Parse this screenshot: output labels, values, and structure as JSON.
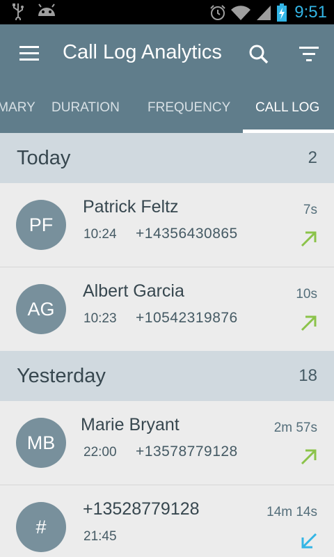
{
  "status_bar": {
    "time": "9:51",
    "icons": [
      "usb-icon",
      "android-icon",
      "alarm-icon",
      "wifi-icon",
      "signal-icon",
      "battery-charging-icon"
    ]
  },
  "toolbar": {
    "title": "Call Log Analytics",
    "menu_icon": "menu-icon",
    "search_icon": "search-icon",
    "filter_icon": "filter-icon"
  },
  "tabs": [
    {
      "label": "SUMMARY",
      "active": false
    },
    {
      "label": "DURATION",
      "active": false
    },
    {
      "label": "FREQUENCY",
      "active": false
    },
    {
      "label": "CALL LOG",
      "active": true
    }
  ],
  "sections": [
    {
      "title": "Today",
      "count": "2",
      "calls": [
        {
          "initials": "PF",
          "name": "Patrick Feltz",
          "time": "10:24",
          "number": "+14356430865",
          "duration": "7s",
          "direction": "outgoing"
        },
        {
          "initials": "AG",
          "name": "Albert Garcia",
          "time": "10:23",
          "number": "+10542319876",
          "duration": "10s",
          "direction": "outgoing"
        }
      ]
    },
    {
      "title": "Yesterday",
      "count": "18",
      "calls": [
        {
          "initials": "MB",
          "name": "Marie Bryant",
          "time": "22:00",
          "number": "+13578779128",
          "duration": "2m 57s",
          "direction": "outgoing"
        },
        {
          "initials": "#",
          "name": "+13528779128",
          "time": "21:45",
          "number": "",
          "duration": "14m 14s",
          "direction": "incoming"
        }
      ]
    }
  ],
  "colors": {
    "primary": "#607d8b",
    "avatar": "#78909c",
    "section_header": "#d0d9df",
    "outgoing": "#8bc34a",
    "incoming": "#33b5e5"
  }
}
